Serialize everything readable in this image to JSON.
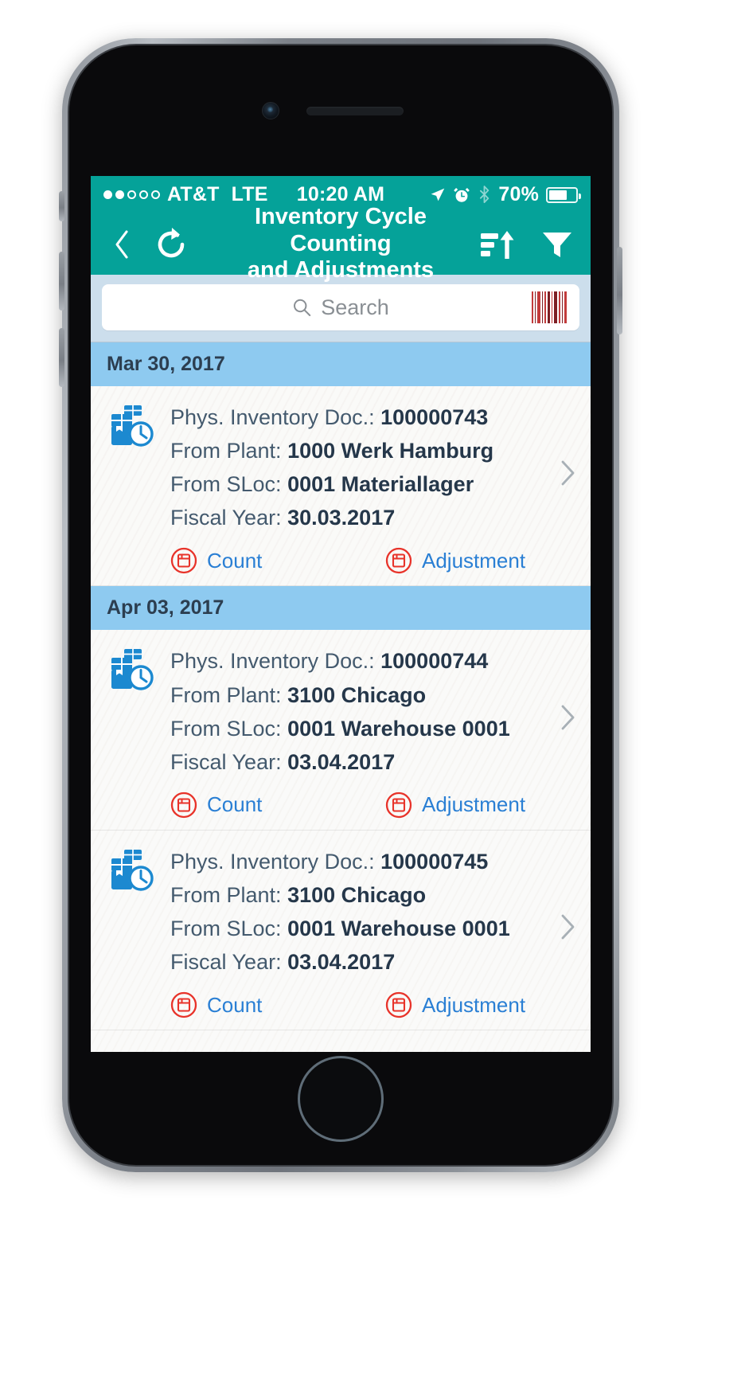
{
  "status_bar": {
    "signal_dots_filled": 2,
    "signal_dots_total": 5,
    "carrier": "AT&T",
    "network": "LTE",
    "time": "10:20 AM",
    "battery_percent": "70%",
    "battery_level": 70,
    "icons": [
      "location-arrow-icon",
      "alarm-clock-icon",
      "bluetooth-icon",
      "battery-icon"
    ]
  },
  "navbar": {
    "back_label": "‹",
    "refresh_label": "refresh-icon",
    "title_line1": "Inventory Cycle Counting",
    "title_line2": "and Adjustments",
    "sort_label": "sort-ascending-icon",
    "filter_label": "filter-icon",
    "bg_color": "#05a299"
  },
  "search": {
    "placeholder": "Search",
    "scan_label": "barcode-scan-icon",
    "zone_color": "#ccdeec"
  },
  "list": {
    "section_header_color": "#8ecaf0",
    "action_link_color": "#2a7fd4",
    "action_icon_color": "#e8332a",
    "sections": [
      {
        "date": "Mar 30, 2017",
        "items": [
          {
            "doc_label": "Phys. Inventory Doc.:",
            "doc_value": "100000743",
            "plant_label": "From Plant:",
            "plant_value": "1000 Werk Hamburg",
            "sloc_label": "From SLoc:",
            "sloc_value": "0001 Materiallager",
            "fiscal_label": "Fiscal Year:",
            "fiscal_value": "30.03.2017",
            "action_count": "Count",
            "action_adjustment": "Adjustment"
          }
        ]
      },
      {
        "date": "Apr 03, 2017",
        "items": [
          {
            "doc_label": "Phys. Inventory Doc.:",
            "doc_value": "100000744",
            "plant_label": "From Plant:",
            "plant_value": "3100 Chicago",
            "sloc_label": "From SLoc:",
            "sloc_value": "0001 Warehouse 0001",
            "fiscal_label": "Fiscal Year:",
            "fiscal_value": "03.04.2017",
            "action_count": "Count",
            "action_adjustment": "Adjustment"
          },
          {
            "doc_label": "Phys. Inventory Doc.:",
            "doc_value": "100000745",
            "plant_label": "From Plant:",
            "plant_value": "3100 Chicago",
            "sloc_label": "From SLoc:",
            "sloc_value": "0001 Warehouse 0001",
            "fiscal_label": "Fiscal Year:",
            "fiscal_value": "03.04.2017",
            "action_count": "Count",
            "action_adjustment": "Adjustment"
          }
        ]
      }
    ]
  }
}
